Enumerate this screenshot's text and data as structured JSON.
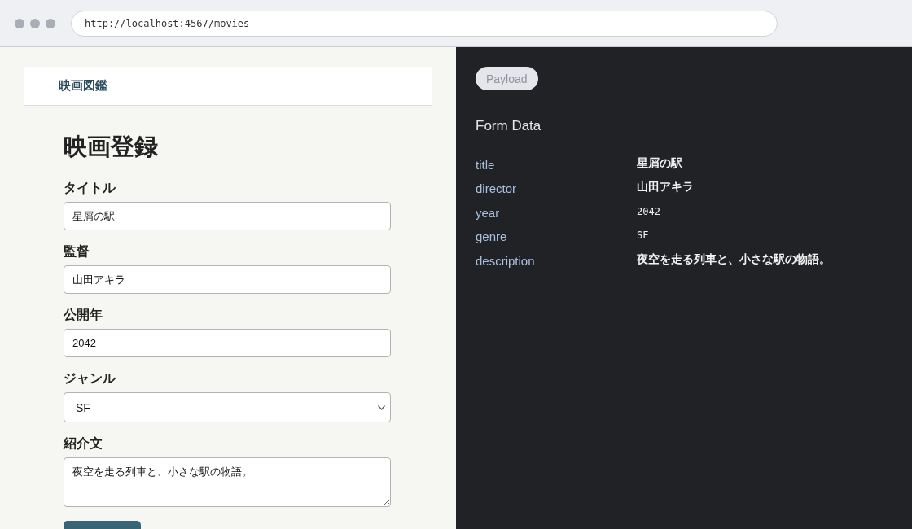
{
  "browser": {
    "url": "http://localhost:4567/movies"
  },
  "site_header": {
    "brand": "映画図鑑"
  },
  "form": {
    "title": "映画登録",
    "fields": [
      {
        "label": "タイトル",
        "kind": "text",
        "value": "星屑の駅"
      },
      {
        "label": "監督",
        "kind": "text",
        "value": "山田アキラ"
      },
      {
        "label": "公開年",
        "kind": "text",
        "value": "2042"
      },
      {
        "label": "ジャンル",
        "kind": "select",
        "value": "SF"
      },
      {
        "label": "紹介文",
        "kind": "textarea",
        "value": "夜空を走る列車と、小さな駅の物語。"
      }
    ]
  },
  "payload_panel": {
    "tab": {
      "label": "Payload"
    },
    "title": "Form Data",
    "rows": [
      {
        "key": "title",
        "value": "星屑の駅",
        "kind": "text"
      },
      {
        "key": "director",
        "value": "山田アキラ",
        "kind": "text"
      },
      {
        "key": "year",
        "value": "2042",
        "kind": "mono"
      },
      {
        "key": "genre",
        "value": "SF",
        "kind": "mono"
      },
      {
        "key": "description",
        "value": "夜空を走る列車と、小さな駅の物語。",
        "kind": "text"
      }
    ]
  }
}
